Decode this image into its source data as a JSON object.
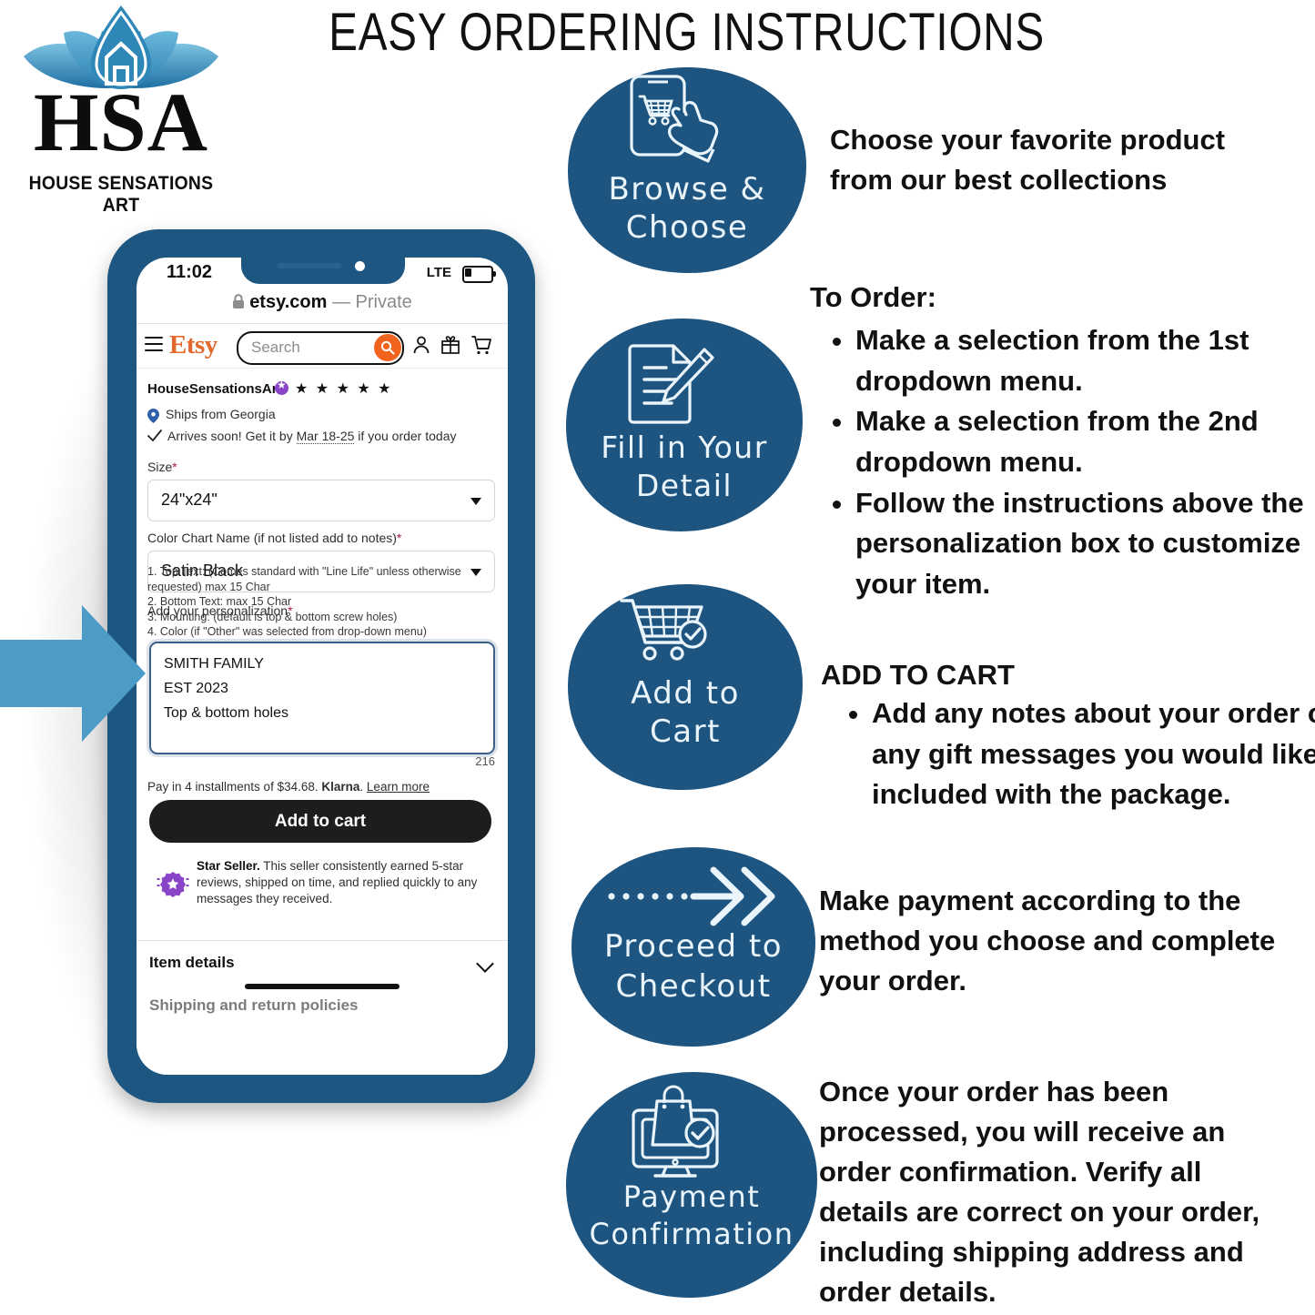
{
  "page": {
    "title": "EASY ORDERING INSTRUCTIONS"
  },
  "brand": {
    "logo_icon": "lotus-house-logo",
    "initials": "HSA",
    "name": "HOUSE SENSATIONS ART",
    "accent_blue": "#4d9bc7",
    "deep_blue": "#1d5681"
  },
  "phone": {
    "status": {
      "time": "11:02",
      "network": "LTE",
      "battery_icon": "battery-low-icon"
    },
    "browser": {
      "lock_icon": "lock-icon",
      "domain": "etsy.com",
      "mode": "— Private"
    },
    "etsy_header": {
      "menu_icon": "hamburger-menu-icon",
      "wordmark": "Etsy",
      "search_placeholder": "Search",
      "search_icon": "search-icon",
      "account_icon": "user-icon",
      "gift_icon": "gift-icon",
      "cart_icon": "cart-icon",
      "search_button_color": "#f1641e"
    },
    "listing": {
      "shop_name": "HouseSensationsArt",
      "star_seller_badge_icon": "star-seller-badge-icon",
      "rating_stars": "★ ★ ★ ★ ★",
      "ships_icon": "location-pin-icon",
      "ships_from": "Ships from Georgia",
      "arrives_icon": "checkmark-icon",
      "arrives_prefix": "Arrives soon! Get it by ",
      "arrives_date": "Mar 18-25",
      "arrives_suffix": " if you order today",
      "size_label": "Size",
      "size_value": "24\"x24\"",
      "color_label": "Color Chart Name (if not listed add to notes)",
      "color_value": "Satin Black",
      "personalization_label": "Add your personalization",
      "required_mark": "*",
      "personalization_lines": [
        "1. Top Text: (Comes standard with \"Line Life\" unless otherwise",
        "requested) max 15 Char",
        "2. Bottom Text: max 15 Char",
        "3. Mounting: (default is top & bottom screw holes)",
        "4. Color (if \"Other\" was selected from drop-down menu)"
      ],
      "personalization_value": [
        "SMITH FAMILY",
        "EST 2023",
        "Top & bottom holes"
      ],
      "char_counter": "216",
      "klarna_prefix": "Pay in 4 installments of $34.68. ",
      "klarna_brand": "Klarna",
      "klarna_suffix": ". ",
      "klarna_link": "Learn more",
      "add_to_cart_label": "Add to cart",
      "star_seller_title": "Star Seller.",
      "star_seller_body": " This seller consistently earned 5-star reviews, shipped on time, and replied quickly to any messages they received.",
      "item_details_label": "Item details",
      "item_details_chevron": "chevron-down-icon",
      "shipping_policies_label": "Shipping and return policies"
    }
  },
  "pointer": {
    "icon": "right-arrow-pointer",
    "color": "#4d9bc7"
  },
  "steps": [
    {
      "icon": "phone-cart-tap-icon",
      "label_line1": "Browse &",
      "label_line2": "Choose"
    },
    {
      "icon": "document-pencil-icon",
      "label_line1": "Fill in Your",
      "label_line2": "Detail"
    },
    {
      "icon": "cart-check-icon",
      "label_line1": "Add to",
      "label_line2": "Cart"
    },
    {
      "icon": "dotted-arrow-icon",
      "label_line1": "Proceed to",
      "label_line2": "Checkout"
    },
    {
      "icon": "monitor-bag-check-icon",
      "label_line1": "Payment",
      "label_line2": "Confirmation"
    }
  ],
  "instructions": {
    "step1_text": "Choose your favorite product from our best collections",
    "to_order_heading": "To Order:",
    "to_order_bullets": [
      "Make a selection from the 1st dropdown menu.",
      " Make a selection from the 2nd dropdown menu.",
      "Follow the instructions above the personalization box to customize your item."
    ],
    "add_to_cart_heading": "ADD TO CART",
    "add_to_cart_bullets": [
      "Add any notes about your order or any gift messages you would like included with the package."
    ],
    "payment_text": "Make payment according to the method you choose and complete your order.",
    "confirmation_text": "Once your order has been processed, you will receive an order confirmation. Verify all details are correct on your order, including shipping address and order details."
  }
}
